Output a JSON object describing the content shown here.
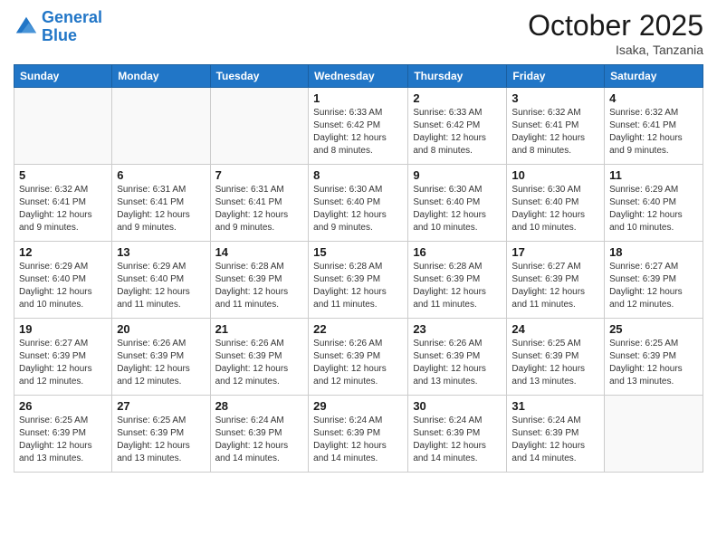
{
  "header": {
    "logo_line1": "General",
    "logo_line2": "Blue",
    "month": "October 2025",
    "location": "Isaka, Tanzania"
  },
  "weekdays": [
    "Sunday",
    "Monday",
    "Tuesday",
    "Wednesday",
    "Thursday",
    "Friday",
    "Saturday"
  ],
  "weeks": [
    [
      {
        "day": "",
        "sunrise": "",
        "sunset": "",
        "daylight": ""
      },
      {
        "day": "",
        "sunrise": "",
        "sunset": "",
        "daylight": ""
      },
      {
        "day": "",
        "sunrise": "",
        "sunset": "",
        "daylight": ""
      },
      {
        "day": "1",
        "sunrise": "Sunrise: 6:33 AM",
        "sunset": "Sunset: 6:42 PM",
        "daylight": "Daylight: 12 hours and 8 minutes."
      },
      {
        "day": "2",
        "sunrise": "Sunrise: 6:33 AM",
        "sunset": "Sunset: 6:42 PM",
        "daylight": "Daylight: 12 hours and 8 minutes."
      },
      {
        "day": "3",
        "sunrise": "Sunrise: 6:32 AM",
        "sunset": "Sunset: 6:41 PM",
        "daylight": "Daylight: 12 hours and 8 minutes."
      },
      {
        "day": "4",
        "sunrise": "Sunrise: 6:32 AM",
        "sunset": "Sunset: 6:41 PM",
        "daylight": "Daylight: 12 hours and 9 minutes."
      }
    ],
    [
      {
        "day": "5",
        "sunrise": "Sunrise: 6:32 AM",
        "sunset": "Sunset: 6:41 PM",
        "daylight": "Daylight: 12 hours and 9 minutes."
      },
      {
        "day": "6",
        "sunrise": "Sunrise: 6:31 AM",
        "sunset": "Sunset: 6:41 PM",
        "daylight": "Daylight: 12 hours and 9 minutes."
      },
      {
        "day": "7",
        "sunrise": "Sunrise: 6:31 AM",
        "sunset": "Sunset: 6:41 PM",
        "daylight": "Daylight: 12 hours and 9 minutes."
      },
      {
        "day": "8",
        "sunrise": "Sunrise: 6:30 AM",
        "sunset": "Sunset: 6:40 PM",
        "daylight": "Daylight: 12 hours and 9 minutes."
      },
      {
        "day": "9",
        "sunrise": "Sunrise: 6:30 AM",
        "sunset": "Sunset: 6:40 PM",
        "daylight": "Daylight: 12 hours and 10 minutes."
      },
      {
        "day": "10",
        "sunrise": "Sunrise: 6:30 AM",
        "sunset": "Sunset: 6:40 PM",
        "daylight": "Daylight: 12 hours and 10 minutes."
      },
      {
        "day": "11",
        "sunrise": "Sunrise: 6:29 AM",
        "sunset": "Sunset: 6:40 PM",
        "daylight": "Daylight: 12 hours and 10 minutes."
      }
    ],
    [
      {
        "day": "12",
        "sunrise": "Sunrise: 6:29 AM",
        "sunset": "Sunset: 6:40 PM",
        "daylight": "Daylight: 12 hours and 10 minutes."
      },
      {
        "day": "13",
        "sunrise": "Sunrise: 6:29 AM",
        "sunset": "Sunset: 6:40 PM",
        "daylight": "Daylight: 12 hours and 11 minutes."
      },
      {
        "day": "14",
        "sunrise": "Sunrise: 6:28 AM",
        "sunset": "Sunset: 6:39 PM",
        "daylight": "Daylight: 12 hours and 11 minutes."
      },
      {
        "day": "15",
        "sunrise": "Sunrise: 6:28 AM",
        "sunset": "Sunset: 6:39 PM",
        "daylight": "Daylight: 12 hours and 11 minutes."
      },
      {
        "day": "16",
        "sunrise": "Sunrise: 6:28 AM",
        "sunset": "Sunset: 6:39 PM",
        "daylight": "Daylight: 12 hours and 11 minutes."
      },
      {
        "day": "17",
        "sunrise": "Sunrise: 6:27 AM",
        "sunset": "Sunset: 6:39 PM",
        "daylight": "Daylight: 12 hours and 11 minutes."
      },
      {
        "day": "18",
        "sunrise": "Sunrise: 6:27 AM",
        "sunset": "Sunset: 6:39 PM",
        "daylight": "Daylight: 12 hours and 12 minutes."
      }
    ],
    [
      {
        "day": "19",
        "sunrise": "Sunrise: 6:27 AM",
        "sunset": "Sunset: 6:39 PM",
        "daylight": "Daylight: 12 hours and 12 minutes."
      },
      {
        "day": "20",
        "sunrise": "Sunrise: 6:26 AM",
        "sunset": "Sunset: 6:39 PM",
        "daylight": "Daylight: 12 hours and 12 minutes."
      },
      {
        "day": "21",
        "sunrise": "Sunrise: 6:26 AM",
        "sunset": "Sunset: 6:39 PM",
        "daylight": "Daylight: 12 hours and 12 minutes."
      },
      {
        "day": "22",
        "sunrise": "Sunrise: 6:26 AM",
        "sunset": "Sunset: 6:39 PM",
        "daylight": "Daylight: 12 hours and 12 minutes."
      },
      {
        "day": "23",
        "sunrise": "Sunrise: 6:26 AM",
        "sunset": "Sunset: 6:39 PM",
        "daylight": "Daylight: 12 hours and 13 minutes."
      },
      {
        "day": "24",
        "sunrise": "Sunrise: 6:25 AM",
        "sunset": "Sunset: 6:39 PM",
        "daylight": "Daylight: 12 hours and 13 minutes."
      },
      {
        "day": "25",
        "sunrise": "Sunrise: 6:25 AM",
        "sunset": "Sunset: 6:39 PM",
        "daylight": "Daylight: 12 hours and 13 minutes."
      }
    ],
    [
      {
        "day": "26",
        "sunrise": "Sunrise: 6:25 AM",
        "sunset": "Sunset: 6:39 PM",
        "daylight": "Daylight: 12 hours and 13 minutes."
      },
      {
        "day": "27",
        "sunrise": "Sunrise: 6:25 AM",
        "sunset": "Sunset: 6:39 PM",
        "daylight": "Daylight: 12 hours and 13 minutes."
      },
      {
        "day": "28",
        "sunrise": "Sunrise: 6:24 AM",
        "sunset": "Sunset: 6:39 PM",
        "daylight": "Daylight: 12 hours and 14 minutes."
      },
      {
        "day": "29",
        "sunrise": "Sunrise: 6:24 AM",
        "sunset": "Sunset: 6:39 PM",
        "daylight": "Daylight: 12 hours and 14 minutes."
      },
      {
        "day": "30",
        "sunrise": "Sunrise: 6:24 AM",
        "sunset": "Sunset: 6:39 PM",
        "daylight": "Daylight: 12 hours and 14 minutes."
      },
      {
        "day": "31",
        "sunrise": "Sunrise: 6:24 AM",
        "sunset": "Sunset: 6:39 PM",
        "daylight": "Daylight: 12 hours and 14 minutes."
      },
      {
        "day": "",
        "sunrise": "",
        "sunset": "",
        "daylight": ""
      }
    ]
  ]
}
